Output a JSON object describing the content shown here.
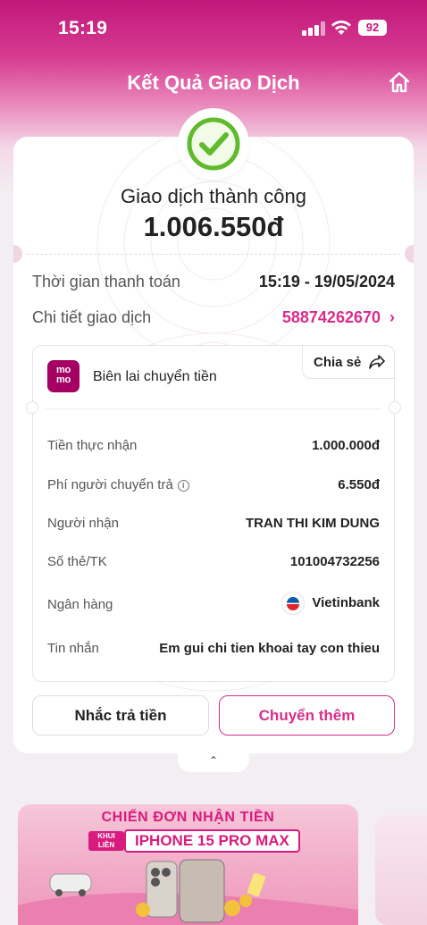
{
  "status_bar": {
    "time": "15:19",
    "battery": "92"
  },
  "header": {
    "title": "Kết Quả Giao Dịch"
  },
  "result": {
    "status": "Giao dịch thành công",
    "amount": "1.006.550đ"
  },
  "info": {
    "payment_time_label": "Thời gian thanh toán",
    "payment_time_value": "15:19 - 19/05/2024",
    "tx_detail_label": "Chi tiết giao dịch",
    "tx_detail_value": "58874262670",
    "tx_chevron": "›"
  },
  "receipt": {
    "logo_text_top": "mo",
    "logo_text_bottom": "mo",
    "title": "Biên lai chuyển tiền",
    "share_label": "Chia sẻ",
    "rows": [
      {
        "label": "Tiền thực nhận",
        "value": "1.000.000đ"
      },
      {
        "label": "Phí người chuyển trả",
        "value": "6.550đ"
      },
      {
        "label": "Người nhận",
        "value": "TRAN THI KIM DUNG"
      },
      {
        "label": "Số thẻ/TK",
        "value": "101004732256"
      },
      {
        "label": "Ngân hàng",
        "value": "Vietinbank"
      },
      {
        "label": "Tin nhắn",
        "value": "Em gui chi tien khoai tay con thieu"
      }
    ]
  },
  "actions": {
    "remind_label": "Nhắc trả tiền",
    "transfer_more_label": "Chuyển thêm"
  },
  "collapse": {
    "glyph": "⌃"
  },
  "banner": {
    "title": "CHIẾN ĐƠN NHẬN TIỀN",
    "tag_line1": "KHUI",
    "tag_line2": "LIỀN",
    "product": "IPHONE 15 PRO MAX"
  },
  "colors": {
    "brand": "#d82d8b",
    "success": "#5fba2c",
    "momo": "#a50064"
  },
  "icons": [
    "signal-icon",
    "wifi-icon",
    "battery-icon",
    "home-icon",
    "check-icon",
    "share-icon",
    "chevron-right-icon",
    "info-icon",
    "vietinbank-logo",
    "chevron-up-icon"
  ]
}
